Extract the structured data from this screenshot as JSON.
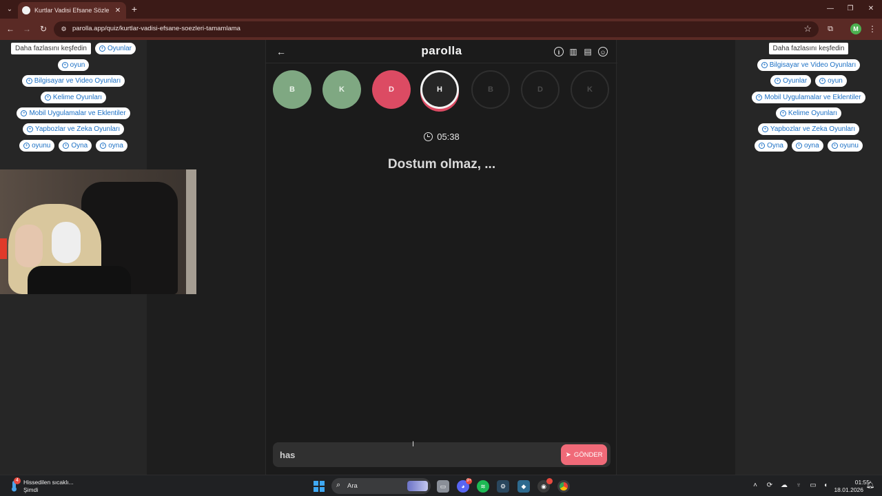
{
  "browser": {
    "tab_title": "Kurtlar Vadisi Efsane Sözleri Tamamlama",
    "url": "parolla.app/quiz/kurtlar-vadisi-efsane-soezleri-tamamlama",
    "profile_initial": "M",
    "new_tab_label": "+"
  },
  "left_ads": {
    "header": "Daha fazlasını keşfedin",
    "rows": [
      [
        "Oyunlar"
      ],
      [
        "oyun"
      ],
      [
        "Bilgisayar ve Video Oyunları"
      ],
      [
        "Kelime Oyunları"
      ],
      [
        "Mobil Uygulamalar ve Eklentiler"
      ],
      [
        "Yapbozlar ve Zeka Oyunları"
      ],
      [
        "oyunu",
        "Oyna",
        "oyna"
      ]
    ]
  },
  "right_ads": {
    "header": "Daha fazlasını keşfedin",
    "rows": [
      [
        "Bilgisayar ve Video Oyunları"
      ],
      [
        "Oyunlar",
        "oyun"
      ],
      [
        "Mobil Uygulamalar ve Eklentiler"
      ],
      [
        "Kelime Oyunları"
      ],
      [
        "Yapbozlar ve Zeka Oyunları"
      ],
      [
        "Oyna",
        "oyna",
        "oyunu"
      ]
    ]
  },
  "game": {
    "logo": "parolla",
    "letters": [
      {
        "letter": "B",
        "state": "correct"
      },
      {
        "letter": "K",
        "state": "correct"
      },
      {
        "letter": "D",
        "state": "wrong"
      },
      {
        "letter": "H",
        "state": "current"
      },
      {
        "letter": "B",
        "state": "pending"
      },
      {
        "letter": "D",
        "state": "pending"
      },
      {
        "letter": "K",
        "state": "pending"
      }
    ],
    "timer": "05:38",
    "question": "Dostum olmaz, ...",
    "answer_value": "has",
    "send_label": "GÖNDER",
    "colors": {
      "correct": "#7fa882",
      "wrong": "#dc4b63",
      "send": "#f06a78"
    }
  },
  "taskbar": {
    "weather_title": "Hissedilen sıcaklı...",
    "weather_sub": "Şimdi",
    "weather_badge": "4",
    "search_placeholder": "Ara",
    "discord_badge": "9+",
    "time": "01:55",
    "date": "18.01.2026"
  },
  "icons": [
    "back-arrow-icon",
    "info-icon",
    "stats-icon",
    "chat-icon",
    "user-icon",
    "clock-icon",
    "send-icon",
    "search-icon",
    "windows-start-icon"
  ]
}
